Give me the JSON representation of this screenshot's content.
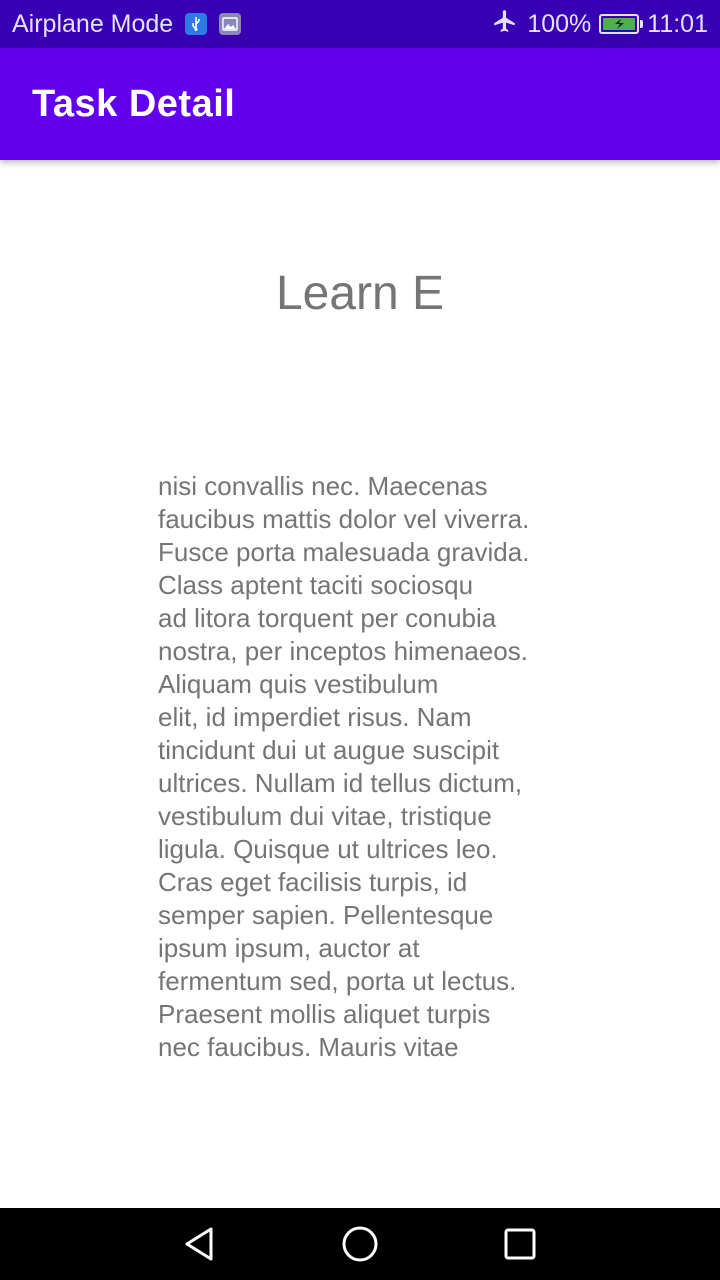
{
  "status_bar": {
    "mode_text": "Airplane Mode",
    "battery_text": "100%",
    "time": "11:01",
    "icons": [
      "usb-icon",
      "image-icon",
      "airplane-icon",
      "battery-charging-icon"
    ]
  },
  "app_bar": {
    "title": "Task Detail",
    "color": "#6200ee"
  },
  "task": {
    "title": "Learn E",
    "body": "nisi convallis nec. Maecenas\nfaucibus mattis dolor vel viverra.\nFusce porta malesuada gravida.\nClass aptent taciti sociosqu\nad litora torquent per conubia\nnostra, per inceptos himenaeos.\nAliquam quis vestibulum\nelit, id imperdiet risus.  Nam\ntincidunt dui ut augue suscipit\nultrices. Nullam id tellus dictum,\nvestibulum dui vitae, tristique\nligula. Quisque ut ultrices leo.\nCras eget facilisis turpis, id\nsemper sapien. Pellentesque\nipsum ipsum, auctor at\nfermentum sed, porta ut lectus.\nPraesent mollis aliquet turpis\nnec faucibus. Mauris vitae"
  },
  "nav_bar": {
    "icons": [
      "back-icon",
      "home-icon",
      "recents-icon"
    ]
  }
}
